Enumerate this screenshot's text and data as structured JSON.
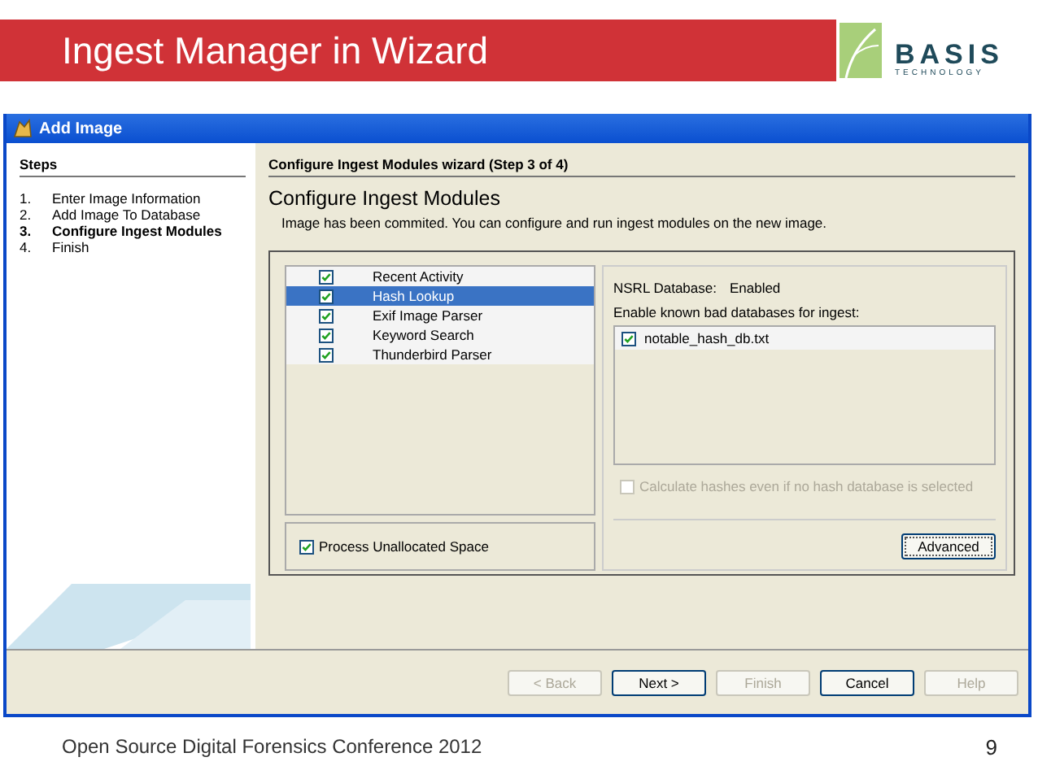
{
  "slide": {
    "title": "Ingest Manager in Wizard",
    "logo": {
      "name": "BASIS",
      "tagline": "TECHNOLOGY"
    },
    "footer": "Open Source Digital Forensics Conference 2012",
    "page_number": "9"
  },
  "window": {
    "title": "Add Image"
  },
  "steps": {
    "heading": "Steps",
    "items": [
      {
        "number": "1.",
        "label": "Enter Image Information",
        "selected": false
      },
      {
        "number": "2.",
        "label": "Add Image To Database",
        "selected": false
      },
      {
        "number": "3.",
        "label": "Configure Ingest Modules",
        "selected": true
      },
      {
        "number": "4.",
        "label": "Finish",
        "selected": false
      }
    ]
  },
  "wizard": {
    "step_title": "Configure Ingest Modules wizard (Step 3 of 4)",
    "heading": "Configure Ingest Modules",
    "description": "Image has been commited.  You can configure and run ingest modules on the new image."
  },
  "modules": [
    {
      "label": "Recent Activity",
      "checked": true,
      "selected": false
    },
    {
      "label": "Hash Lookup",
      "checked": true,
      "selected": true
    },
    {
      "label": "Exif Image Parser",
      "checked": true,
      "selected": false
    },
    {
      "label": "Keyword Search",
      "checked": true,
      "selected": false
    },
    {
      "label": "Thunderbird Parser",
      "checked": true,
      "selected": false
    }
  ],
  "process_unallocated": {
    "label": "Process Unallocated Space",
    "checked": true
  },
  "settings": {
    "nsrl_label": "NSRL Database:",
    "nsrl_value": "Enabled",
    "databases_label": "Enable known bad databases for ingest:",
    "databases": [
      {
        "label": "notable_hash_db.txt",
        "checked": true
      }
    ],
    "calculate_hashes": {
      "label": "Calculate hashes even if no hash database is selected",
      "checked": false,
      "disabled": true
    },
    "advanced_button": "Advanced"
  },
  "buttons": [
    {
      "label": "< Back",
      "disabled": true
    },
    {
      "label": "Next >",
      "disabled": false
    },
    {
      "label": "Finish",
      "disabled": true
    },
    {
      "label": "Cancel",
      "disabled": false
    },
    {
      "label": "Help",
      "disabled": true
    }
  ]
}
